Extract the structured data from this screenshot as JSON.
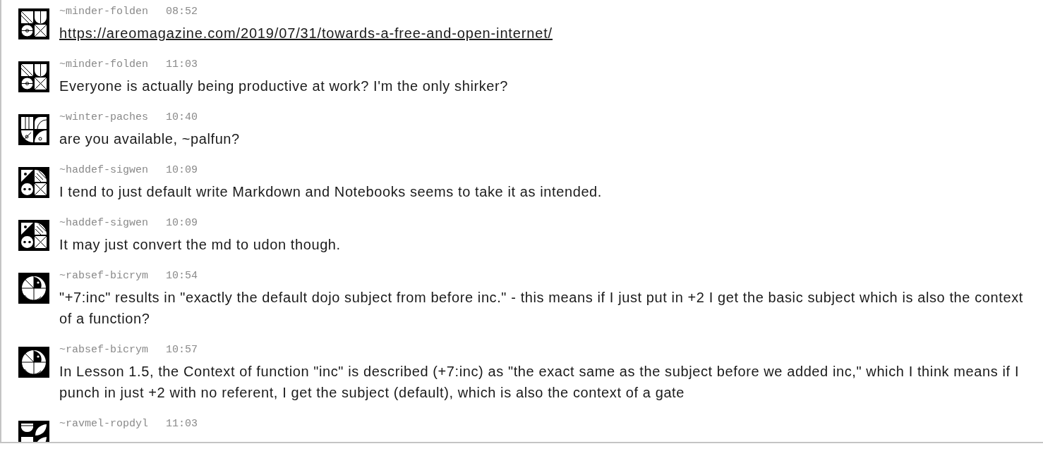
{
  "messages": [
    {
      "author": "~minder-folden",
      "time": "08:52",
      "avatar": {
        "kind": "grid"
      },
      "kind": "link",
      "text": "https://areomagazine.com/2019/07/31/towards-a-free-and-open-internet/"
    },
    {
      "author": "~minder-folden",
      "time": "11:03",
      "avatar": {
        "kind": "grid"
      },
      "kind": "text",
      "text": "Everyone is actually being productive at work? I'm the only shirker?"
    },
    {
      "author": "~winter-paches",
      "time": "10:40",
      "avatar": {
        "kind": "arch"
      },
      "kind": "text",
      "text": "are you available, ~palfun?"
    },
    {
      "author": "~haddef-sigwen",
      "time": "10:09",
      "avatar": {
        "kind": "dots"
      },
      "kind": "text",
      "text": "I tend to just default write Markdown and Notebooks seems to take it as intended."
    },
    {
      "author": "~haddef-sigwen",
      "time": "10:09",
      "avatar": {
        "kind": "dots"
      },
      "kind": "text",
      "text": "It may just convert the md to udon though."
    },
    {
      "author": "~rabsef-bicrym",
      "time": "10:54",
      "avatar": {
        "kind": "disc"
      },
      "kind": "text",
      "text": "\"+7:inc\" results in \"exactly the default dojo subject from before inc.\" - this means if I just put in +2 I get the basic subject which is also the context of a function?"
    },
    {
      "author": "~rabsef-bicrym",
      "time": "10:57",
      "avatar": {
        "kind": "disc"
      },
      "kind": "text",
      "text": "In Lesson 1.5, the Context of function \"inc\" is described (+7:inc) as \"the exact same as the subject before we added inc,\" which I think means if I punch in just +2 with no referent, I get the subject (default), which is also the context of a gate"
    },
    {
      "author": "~ravmel-ropdyl",
      "time": "11:03",
      "avatar": {
        "kind": "leaf"
      }
    }
  ]
}
